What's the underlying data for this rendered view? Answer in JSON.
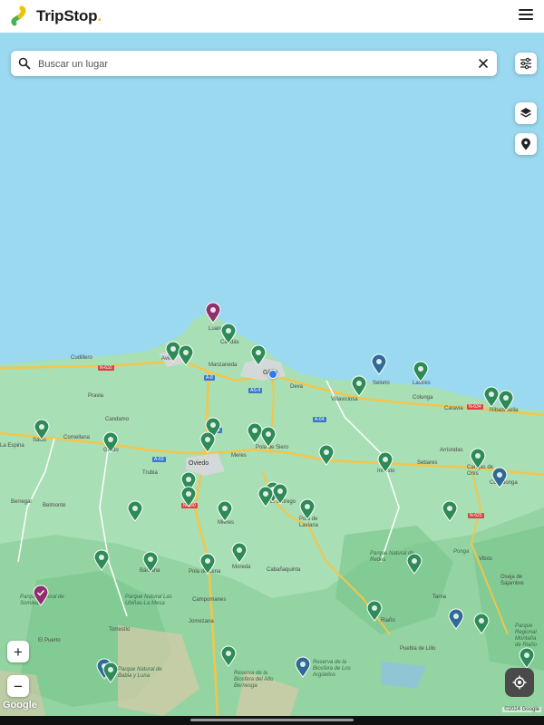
{
  "app": {
    "name": "TripStop",
    "name_suffix": "."
  },
  "search": {
    "placeholder": "Buscar un lugar",
    "value": ""
  },
  "map": {
    "places": [
      {
        "id": "cudillero",
        "text": "Cudillero"
      },
      {
        "id": "pravia",
        "text": "Pravia"
      },
      {
        "id": "luanco",
        "text": "Luanco"
      },
      {
        "id": "candas",
        "text": "Candás"
      },
      {
        "id": "aviles",
        "text": "Avilés"
      },
      {
        "id": "manzaneda",
        "text": "Manzaneda"
      },
      {
        "id": "gijon",
        "text": "Gijón"
      },
      {
        "id": "deva",
        "text": "Deva"
      },
      {
        "id": "villaviciosa",
        "text": "Villaviciosa"
      },
      {
        "id": "selorio",
        "text": "Selorio"
      },
      {
        "id": "lastres",
        "text": "Lastres"
      },
      {
        "id": "colunga",
        "text": "Colunga"
      },
      {
        "id": "caravia",
        "text": "Caravia"
      },
      {
        "id": "ribadesella",
        "text": "Ribadesella"
      },
      {
        "id": "candamo",
        "text": "Candamo"
      },
      {
        "id": "laespina",
        "text": "La Espina"
      },
      {
        "id": "salas",
        "text": "Salas"
      },
      {
        "id": "cornellana",
        "text": "Cornellana"
      },
      {
        "id": "grado",
        "text": "Grado"
      },
      {
        "id": "trubia",
        "text": "Trubia"
      },
      {
        "id": "oviedo",
        "text": "Oviedo"
      },
      {
        "id": "meres",
        "text": "Meres"
      },
      {
        "id": "polasiero",
        "text": "Pola de Siero"
      },
      {
        "id": "infiesto",
        "text": "Infiesto"
      },
      {
        "id": "sebares",
        "text": "Sebares"
      },
      {
        "id": "arriondas",
        "text": "Arriondas"
      },
      {
        "id": "cangas",
        "text": "Cangas de Onís"
      },
      {
        "id": "covadonga",
        "text": "Covadonga"
      },
      {
        "id": "berregal",
        "text": "Berregal"
      },
      {
        "id": "belmonte",
        "text": "Belmonte"
      },
      {
        "id": "mieres",
        "text": "Mieres"
      },
      {
        "id": "entrego",
        "text": "El Entrego"
      },
      {
        "id": "laviana",
        "text": "Pola de Laviana"
      },
      {
        "id": "barzana",
        "text": "Bárzana"
      },
      {
        "id": "polalena",
        "text": "Pola de Lena"
      },
      {
        "id": "moreda",
        "text": "Moreda"
      },
      {
        "id": "cabanaquinta",
        "text": "Cabañaquinta"
      },
      {
        "id": "campomanes",
        "text": "Campomanes"
      },
      {
        "id": "somiedo",
        "text": "Parque Natural de Somiedo"
      },
      {
        "id": "ubinas",
        "text": "Parque Natural Las Ubiñas-La Mesa"
      },
      {
        "id": "redes",
        "text": "Parque Natural de Redes"
      },
      {
        "id": "ponga",
        "text": "Ponga"
      },
      {
        "id": "vibo",
        "text": "Vibós"
      },
      {
        "id": "oseja",
        "text": "Oseja de Sajambre"
      },
      {
        "id": "tarna",
        "text": "Tarna"
      },
      {
        "id": "riano",
        "text": "Riaño"
      },
      {
        "id": "puebla",
        "text": "Puebla de Lillo"
      },
      {
        "id": "torrestio",
        "text": "Torrestío"
      },
      {
        "id": "elpuerto",
        "text": "El Puerto"
      },
      {
        "id": "jomezana",
        "text": "Jomezana"
      },
      {
        "id": "babia",
        "text": "Parque Natural de Babia y Luna"
      },
      {
        "id": "arguellos",
        "text": "Reserva de la Biosfera de Los Argüellos"
      },
      {
        "id": "bernesga",
        "text": "Reserva de la Biosfera del Alto Bernesga"
      },
      {
        "id": "montana",
        "text": "Parque Regional Montaña de Riaño"
      }
    ],
    "roads": [
      "N-632",
      "A-8",
      "AS-II",
      "A-66",
      "A-64",
      "N-634",
      "N-630",
      "N-625",
      "A-63"
    ],
    "colors": {
      "sea": "#9ad9f0",
      "land": "#a8dfb5",
      "forest": "#8ccf9a",
      "pin_green": "#2e8b57",
      "pin_blue": "#2f6b94",
      "pin_purple": "#8e2f6e",
      "road": "#f4c54a"
    },
    "attribution": {
      "google": "Google",
      "copyright": "©2024 Google"
    }
  }
}
